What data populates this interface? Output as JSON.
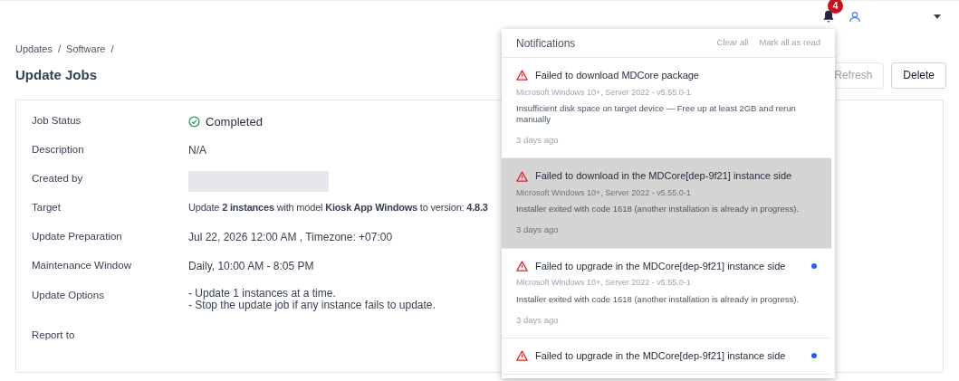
{
  "header": {
    "notification_count": "4"
  },
  "breadcrumb": [
    {
      "label": "Updates",
      "separator": "/"
    },
    {
      "label": "Software",
      "separator": "/"
    }
  ],
  "page_title": "Update Jobs",
  "actions": [
    {
      "label": "Refresh",
      "disabled": true
    },
    {
      "label": "Delete",
      "disabled": false
    }
  ],
  "details": [
    {
      "kind": "status",
      "label": "Job Status",
      "value": "Completed"
    },
    {
      "kind": "text",
      "label": "Description",
      "value": "N/A"
    },
    {
      "kind": "redacted",
      "label": "Created by"
    },
    {
      "kind": "rich",
      "label": "Target",
      "value": "Update **2 instances** with model **Kiosk App Windows** to version: **4.8.3**"
    },
    {
      "kind": "text",
      "label": "Update Preparation",
      "value": "Jul 22, 2026 12:00 AM , Timezone: +07:00"
    },
    {
      "kind": "text",
      "label": "Maintenance Window",
      "value": "Daily, 10:00 AM - 8:05 PM"
    },
    {
      "kind": "lines",
      "label": "Update Options",
      "lines": [
        "- Update 1 instances at a time.",
        "- Stop the update job if any instance fails to update."
      ]
    },
    {
      "kind": "text",
      "label": "Report to"
    }
  ],
  "notifications": {
    "title": "Notifications",
    "clear_all": "Clear all",
    "mark_all_read": "Mark all as read",
    "items": [
      {
        "title": "Failed to download MDCore package",
        "source": "Microsoft Windows 10+, Server 2022 - v5.55.0-1",
        "message": "Insufficient disk space on target device — Free up at least 2GB and rerun manually",
        "time": "3 days ago",
        "unread": false,
        "selected": false
      },
      {
        "title": "Failed to download in the MDCore[dep-9f21] instance side",
        "source": "Microsoft Windows 10+, Server 2022 - v5.55.0-1",
        "message": "Installer exited with code 1618 (another installation is already in progress).",
        "time": "3 days ago",
        "unread": false,
        "selected": true
      },
      {
        "title": "Failed to upgrade in the MDCore[dep-9f21] instance side",
        "source": "Microsoft Windows 10+, Server 2022 - v5.55.0-1",
        "message": "Installer exited with code 1618 (another installation is already in progress).",
        "time": "3 days ago",
        "unread": true,
        "selected": false
      },
      {
        "title": "Failed to upgrade in the MDCore[dep-9f21] instance side",
        "unread": true,
        "selected": false
      }
    ]
  }
}
